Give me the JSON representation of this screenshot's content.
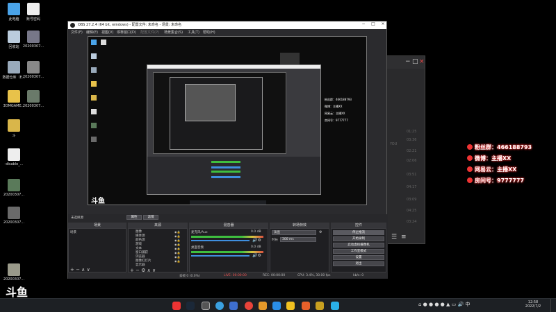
{
  "desktop_icons": [
    {
      "label": "此电脑"
    },
    {
      "label": "账号密码"
    },
    {
      "label": "回收站"
    },
    {
      "label": "20200307..."
    },
    {
      "label": "数据仓库（E..."
    },
    {
      "label": "20200307..."
    },
    {
      "label": "3DMGAME..."
    },
    {
      "label": "20200307..."
    },
    {
      "label": "斗"
    },
    {
      "label": "-disable_..."
    },
    {
      "label": "20200307..."
    },
    {
      "label": "20200307..."
    },
    {
      "label": "20200307..."
    }
  ],
  "obs": {
    "title": "OBS 27.2.4 (64 bit, windows) - 配置文件: 未命名 - 场景: 未命名",
    "menu": [
      "文件(F)",
      "编辑(E)",
      "视图(V)",
      "停靠窗口(D)",
      "配置文件(P)",
      "场景集合(S)",
      "工具(T)",
      "帮助(H)"
    ],
    "no_source": "未选择源",
    "props": "属性",
    "filters": "滤镜",
    "panels": {
      "scenes": "场景",
      "sources": "来源",
      "mixer": "混音器",
      "transitions": "转场特效",
      "controls": "控件"
    },
    "scene_item": "场景",
    "sources": [
      "图像",
      "媒体源",
      "颜色源",
      "游戏",
      "文本",
      "窗口捕获",
      "浏览器",
      "图像幻灯片",
      "显示器"
    ],
    "mixer": {
      "ch1": "麦克风/Aux",
      "ch2": "桌面音频",
      "db1": "0.0 dB",
      "db2": "0.0 dB"
    },
    "transitions": {
      "fade": "淡出",
      "duration_label": "时长",
      "duration": "300 ms"
    },
    "controls": [
      "停止推流",
      "开始录制",
      "启动虚拟摄像机",
      "工作室模式",
      "设置",
      "退出"
    ],
    "status": {
      "drop": "丢帧 0 (0.0%)",
      "live": "LIVE: 00:00:00",
      "rec": "REC: 00:00:00",
      "cpu": "CPU: 3.4%, 30.00 fps",
      "kbps": "kb/s: 0"
    }
  },
  "overlay": {
    "fans": "粉丝群：466188793",
    "weibo": "微博：主播XX",
    "netease": "网易云：主播XX",
    "room": "房间号：9777777"
  },
  "overlay_small": {
    "fans": "粉丝群：466188793",
    "weibo": "微博：主播XX",
    "netease": "网易云：主播XX",
    "room": "房间号：9777777"
  },
  "bg_window": {
    "rows": [
      "01:25",
      "03:36",
      "YOU",
      "02:21",
      "02:06",
      "03:51",
      "04:17",
      "03:09",
      "04:25",
      "03:24"
    ]
  },
  "brand": "斗鱼",
  "taskbar": {
    "clock_time": "12:58",
    "clock_date": "2022/7/2"
  },
  "colors": {
    "accent_red": "#e33333",
    "obs_bg": "#2b2b2e",
    "meter_green": "#3fbf3f",
    "meter_blue": "#3f8fdf"
  }
}
